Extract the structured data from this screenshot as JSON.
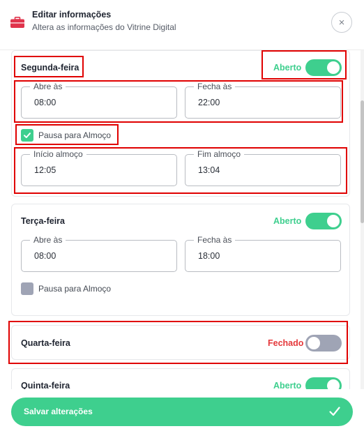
{
  "header": {
    "title": "Editar informações",
    "subtitle": "Altera as informações do Vitrine Digital",
    "close_label": "×"
  },
  "days": [
    {
      "name": "Segunda-feira",
      "status": "Aberto",
      "open": true,
      "opens_label": "Abre às",
      "opens_value": "08:00",
      "closes_label": "Fecha às",
      "closes_value": "22:00",
      "lunch_label": "Pausa para Almoço",
      "lunch_checked": true,
      "lunch_start_label": "Início almoço",
      "lunch_start_value": "12:05",
      "lunch_end_label": "Fim almoço",
      "lunch_end_value": "13:04"
    },
    {
      "name": "Terça-feira",
      "status": "Aberto",
      "open": true,
      "opens_label": "Abre às",
      "opens_value": "08:00",
      "closes_label": "Fecha às",
      "closes_value": "18:00",
      "lunch_label": "Pausa para Almoço",
      "lunch_checked": false
    },
    {
      "name": "Quarta-feira",
      "status": "Fechado",
      "open": false
    },
    {
      "name": "Quinta-feira",
      "status": "Aberto",
      "open": true
    }
  ],
  "footer": {
    "save_label": "Salvar alterações"
  },
  "colors": {
    "accent_green": "#3ecf8e",
    "closed_red": "#e5383b",
    "toggle_off": "#9fa4b5",
    "brand_red": "#e0334b"
  }
}
